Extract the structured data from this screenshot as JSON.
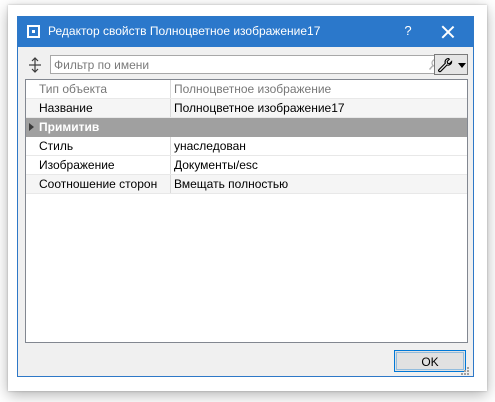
{
  "window": {
    "title": "Редактор свойств Полноцветное изображение17",
    "help_label": "?",
    "accent_color": "#2b78cb"
  },
  "filter": {
    "placeholder": "Фильтр по имени",
    "value": ""
  },
  "grid": {
    "header": {
      "name": "Тип объекта",
      "value": "Полноцветное изображение"
    },
    "rows": [
      {
        "name": "Название",
        "value": "Полноцветное изображение17"
      },
      {
        "group": "Примитив"
      },
      {
        "name": "Стиль",
        "value": "унаследован"
      },
      {
        "name": "Изображение",
        "value": "Документы/esc"
      },
      {
        "name": "Соотношение сторон",
        "value": "Вмещать полностью"
      }
    ]
  },
  "footer": {
    "ok_label": "OK"
  }
}
